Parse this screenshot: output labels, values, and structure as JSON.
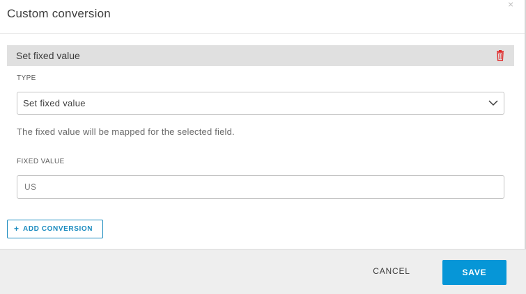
{
  "dialog": {
    "title": "Custom conversion",
    "close_glyph": "×"
  },
  "conversion": {
    "section_title": "Set fixed value",
    "delete_icon": "trash-icon",
    "delete_color": "#e02b2b",
    "type_label": "TYPE",
    "type_selected": "Set fixed value",
    "helper_text": "The fixed value will be mapped for the selected field.",
    "fixed_value_label": "FIXED VALUE",
    "fixed_value": "US"
  },
  "actions": {
    "add_plus": "+",
    "add_label": "ADD CONVERSION",
    "cancel_label": "CANCEL",
    "save_label": "SAVE"
  },
  "colors": {
    "accent": "#0696d7",
    "link": "#1a8bbf",
    "section_bg": "#e0e0e0",
    "footer_bg": "#eeeeee"
  }
}
